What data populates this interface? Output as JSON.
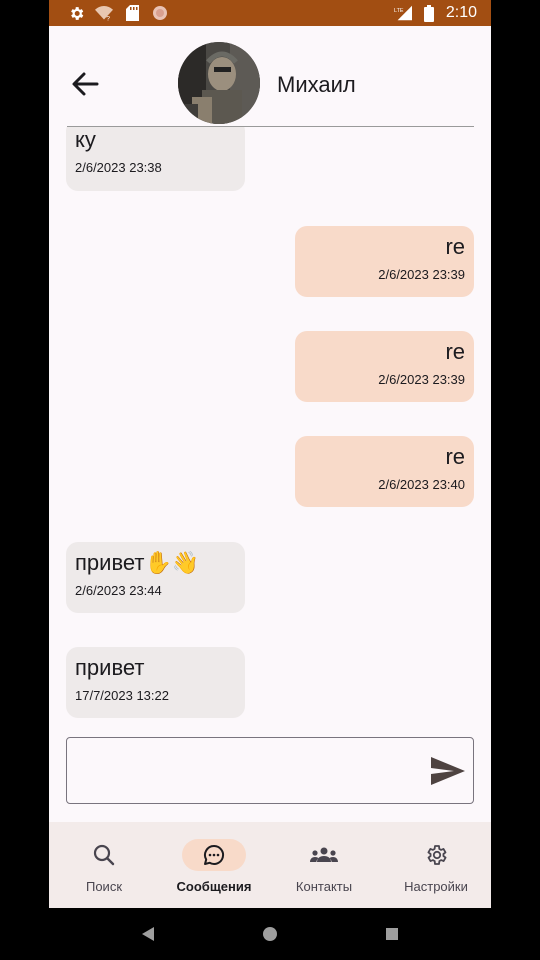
{
  "status_bar": {
    "time": "2:10",
    "network": "LTE",
    "icons": [
      "settings-icon",
      "wifi-question-icon",
      "sd-card-icon",
      "circle-icon",
      "lte-signal-icon",
      "battery-icon"
    ],
    "background": "#a24e12"
  },
  "header": {
    "contact_name": "Михаил",
    "back_icon": "arrow-left-icon",
    "avatar": "contact-avatar"
  },
  "messages": [
    {
      "direction": "in",
      "text": "ку",
      "time": "2/6/2023 23:38"
    },
    {
      "direction": "out",
      "text": "re",
      "time": "2/6/2023 23:39"
    },
    {
      "direction": "out",
      "text": "re",
      "time": "2/6/2023 23:39"
    },
    {
      "direction": "out",
      "text": "re",
      "time": "2/6/2023 23:40"
    },
    {
      "direction": "in",
      "text": "привет✋👋",
      "time": "2/6/2023 23:44"
    },
    {
      "direction": "in",
      "text": "привет",
      "time": "17/7/2023 13:22"
    }
  ],
  "composer": {
    "value": "",
    "placeholder": "",
    "send_icon": "send-icon"
  },
  "bottom_nav": {
    "items": [
      {
        "label": "Поиск",
        "icon": "search-icon",
        "active": false
      },
      {
        "label": "Сообщения",
        "icon": "chat-bubble-icon",
        "active": true
      },
      {
        "label": "Контакты",
        "icon": "people-icon",
        "active": false
      },
      {
        "label": "Настройки",
        "icon": "gear-icon",
        "active": false
      }
    ]
  },
  "colors": {
    "incoming_bubble": "#eeeaea",
    "outgoing_bubble": "#f8dac9",
    "active_nav_pill": "#f8dac9",
    "nav_background": "#f3ebea"
  },
  "system_nav": [
    "back-triangle-icon",
    "home-circle-icon",
    "recents-square-icon"
  ]
}
